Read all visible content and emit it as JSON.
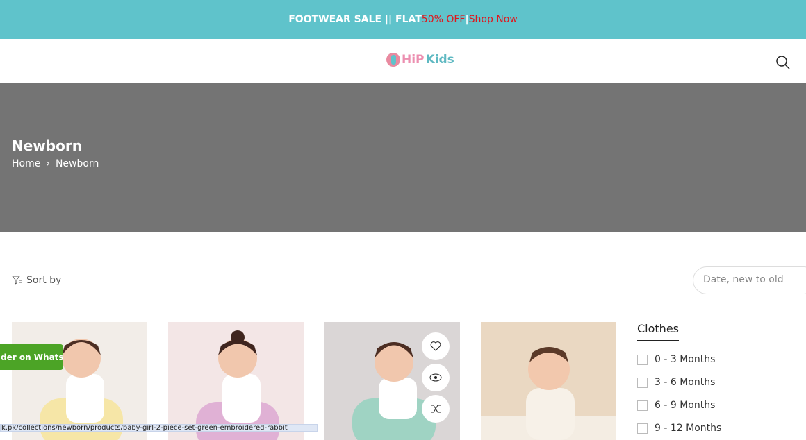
{
  "announcement": {
    "part1": "FOOTWEAR SALE || FLAT ",
    "part2": "50% OFF",
    "part3": " | ",
    "part4": "Shop Now"
  },
  "logo": {
    "part1": "HiP",
    "part2": "Kids"
  },
  "hero": {
    "title": "Newborn",
    "breadcrumb": [
      "Home",
      "Newborn"
    ]
  },
  "sort": {
    "label": "Sort by",
    "selected": "Date, new to old"
  },
  "whatsapp": "der on Whatsapp",
  "sidebar": {
    "title": "Clothes",
    "filters": [
      "0 - 3 Months",
      "3 - 6 Months",
      "6 - 9 Months",
      "9 - 12 Months"
    ]
  },
  "status_url": "k.pk/collections/newborn/products/baby-girl-2-piece-set-green-embroidered-rabbit",
  "colors": {
    "accent": "#5fc3cb",
    "sale_red": "#e0151b",
    "hero_bg": "#747474",
    "whatsapp_green": "#4ca426"
  }
}
